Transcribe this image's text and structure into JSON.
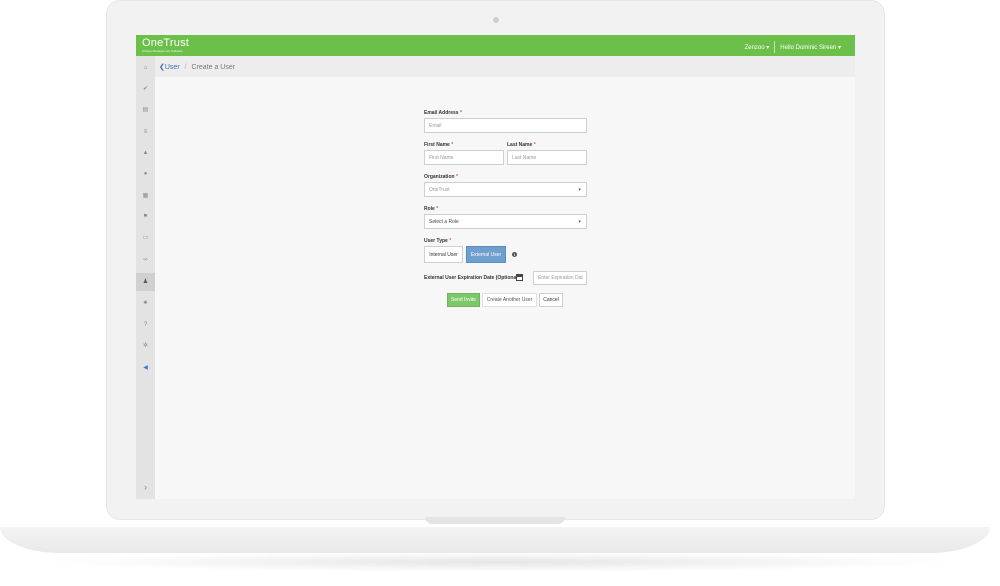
{
  "app": {
    "logo": "OneTrust",
    "logo_sub": "Privacy Management Software",
    "org_menu": "Zenzoo",
    "user_menu": "Hello Dominic Sireen"
  },
  "icons": {
    "caret": "▾",
    "chevron_left": "❮",
    "chevron_right": "›",
    "info": "i"
  },
  "breadcrumb": {
    "parent": "User",
    "separator": "/",
    "current": "Create a User"
  },
  "sidebar": {
    "items": [
      {
        "icon": "home-icon",
        "glyph": "⌂"
      },
      {
        "icon": "check-icon",
        "glyph": "✔"
      },
      {
        "icon": "document-icon",
        "glyph": "▤"
      },
      {
        "icon": "list-icon",
        "glyph": "≡"
      },
      {
        "icon": "building-icon",
        "glyph": "▲"
      },
      {
        "icon": "globe-icon",
        "glyph": "●"
      },
      {
        "icon": "database-icon",
        "glyph": "▦"
      },
      {
        "icon": "flag-icon",
        "glyph": "⚑"
      },
      {
        "icon": "folder-icon",
        "glyph": "▭"
      },
      {
        "icon": "link-icon",
        "glyph": "∞"
      },
      {
        "icon": "user-icon",
        "glyph": "♟"
      },
      {
        "icon": "users-icon",
        "glyph": "♣"
      },
      {
        "icon": "help-icon",
        "glyph": "?"
      },
      {
        "icon": "settings-icon",
        "glyph": "✲"
      },
      {
        "icon": "megaphone-icon",
        "glyph": "◀"
      }
    ],
    "collapse_glyph": "›"
  },
  "form": {
    "email": {
      "label": "Email Address",
      "placeholder": "Email"
    },
    "first_name": {
      "label": "First Name",
      "placeholder": "First Name"
    },
    "last_name": {
      "label": "Last Name",
      "placeholder": "Last Name"
    },
    "organization": {
      "label": "Organization",
      "value": "OneTrust"
    },
    "role": {
      "label": "Role",
      "value": "Select a Role"
    },
    "user_type": {
      "label": "User Type",
      "internal": "Internal User",
      "external": "External User",
      "selected": "External User"
    },
    "expiration": {
      "label": "External User Expiration Date (Optional)",
      "placeholder": "Enter Expiration Dat"
    },
    "required_mark": "*",
    "buttons": {
      "send": "Send Invite",
      "create_another": "Create Another User",
      "cancel": "Cancel"
    }
  },
  "colors": {
    "brand_green": "#6cc04a",
    "active_blue": "#6f9fcf",
    "send_green": "#7cc96a"
  }
}
